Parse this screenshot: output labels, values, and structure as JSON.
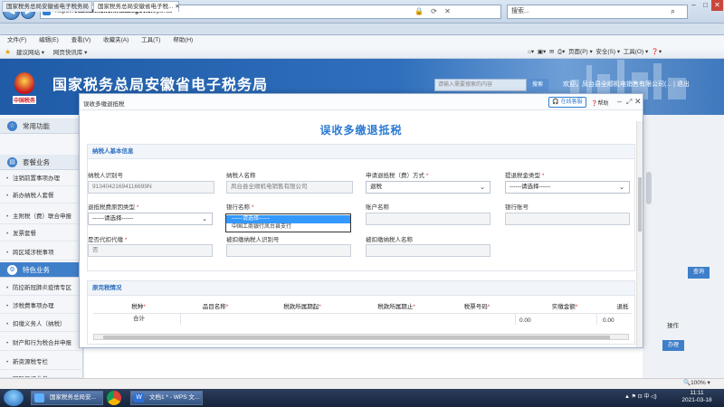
{
  "browser": {
    "url_prefix": "https://",
    "url_domain": "etax.anhui.chinatax.gov.cn",
    "url_path": "/portal",
    "search_placeholder": "搜索...",
    "tabs": [
      {
        "label": "国家税务总局安徽省电子税务局"
      },
      {
        "label": "国家税务总局安徽省电子税..."
      }
    ],
    "menu": [
      "文件(F)",
      "编辑(E)",
      "查看(V)",
      "收藏夹(A)",
      "工具(T)",
      "帮助(H)"
    ],
    "favorites": [
      {
        "label": "建议网站 ▾"
      },
      {
        "label": "网页快讯库 ▾"
      }
    ],
    "tools": [
      "页面(P) ▾",
      "安全(S) ▾",
      "工具(O) ▾",
      "❓▾"
    ],
    "zoom": "🔍100%  ▾"
  },
  "site": {
    "emblem_text": "中国税务",
    "title": "国家税务总局安徽省电子税务局",
    "search_placeholder": "请输入需要搜索的内容",
    "search_button": "搜索",
    "welcome": "欢迎，凤台县全顺机电销售有限公司(...  |  退出"
  },
  "sidebar": {
    "groups": [
      {
        "label": "常用功能",
        "icon": "☆"
      },
      {
        "label": "套餐业务",
        "icon": "▤"
      },
      {
        "label": "特色业务",
        "icon": "⚙"
      }
    ],
    "items_a": [
      "注销前置事项办理",
      "新办纳税人套餐",
      "主附税（费）联合申报",
      "发票套餐",
      "跨区域涉税事项"
    ],
    "items_b": [
      "防控新冠肺炎疫情专区",
      "涉税费事项办理",
      "扣缴义务人（纳税）",
      "财产和行为税合并申报",
      "新资源税专栏",
      "国际三证业务"
    ]
  },
  "background": {
    "query_button": "查询",
    "op_header": "操作",
    "handle_button": "办理"
  },
  "modal": {
    "window_title": "误收多缴退抵税",
    "online_button": "在线客服",
    "help": "❓帮助",
    "form_title": "误收多缴退抵税",
    "basic_section": "纳税人基本信息",
    "fields": {
      "taxpayer_id_label": "纳税人识别号",
      "taxpayer_id_value": "91340421694116699N",
      "taxpayer_name_label": "纳税人名称",
      "taxpayer_name_value": "凤台县全顺机电销售有限公司",
      "refund_method_label": "申请退抵税（费）方式",
      "refund_method_value": "退税",
      "refund_type_label": "提退税金类型",
      "refund_type_value": "------请选择------",
      "reason_type_label": "退抵税费原因类型",
      "reason_type_value": "------请选择------",
      "bank_label": "银行名称",
      "bank_value": "------请选择------",
      "account_name_label": "账户名称",
      "account_no_label": "银行账号",
      "is_withhold_label": "是否代扣代缴",
      "is_withhold_value": "否",
      "withheld_id_label": "被扣缴纳税人识别号",
      "withheld_name_label": "被扣缴纳税人名称"
    },
    "bank_options": [
      "------请选择------",
      "中国工商银行凤台县支行"
    ],
    "paid_section": "原完税情况",
    "table_headers": [
      "税种",
      "品目名称",
      "税款所属期起",
      "税款所属期止",
      "税票号码",
      "实缴金额",
      "退抵"
    ],
    "total_label": "合计",
    "total_values": [
      "0.00",
      "0.00"
    ]
  },
  "taskbar": {
    "apps": [
      {
        "label": "国家税务总局安..."
      },
      {
        "label": "文档1 * - WPS 文..."
      }
    ],
    "tray": "▲ ⚑ ⊡ 中 ◁)",
    "time": "11:11",
    "date": "2021-03-18"
  }
}
